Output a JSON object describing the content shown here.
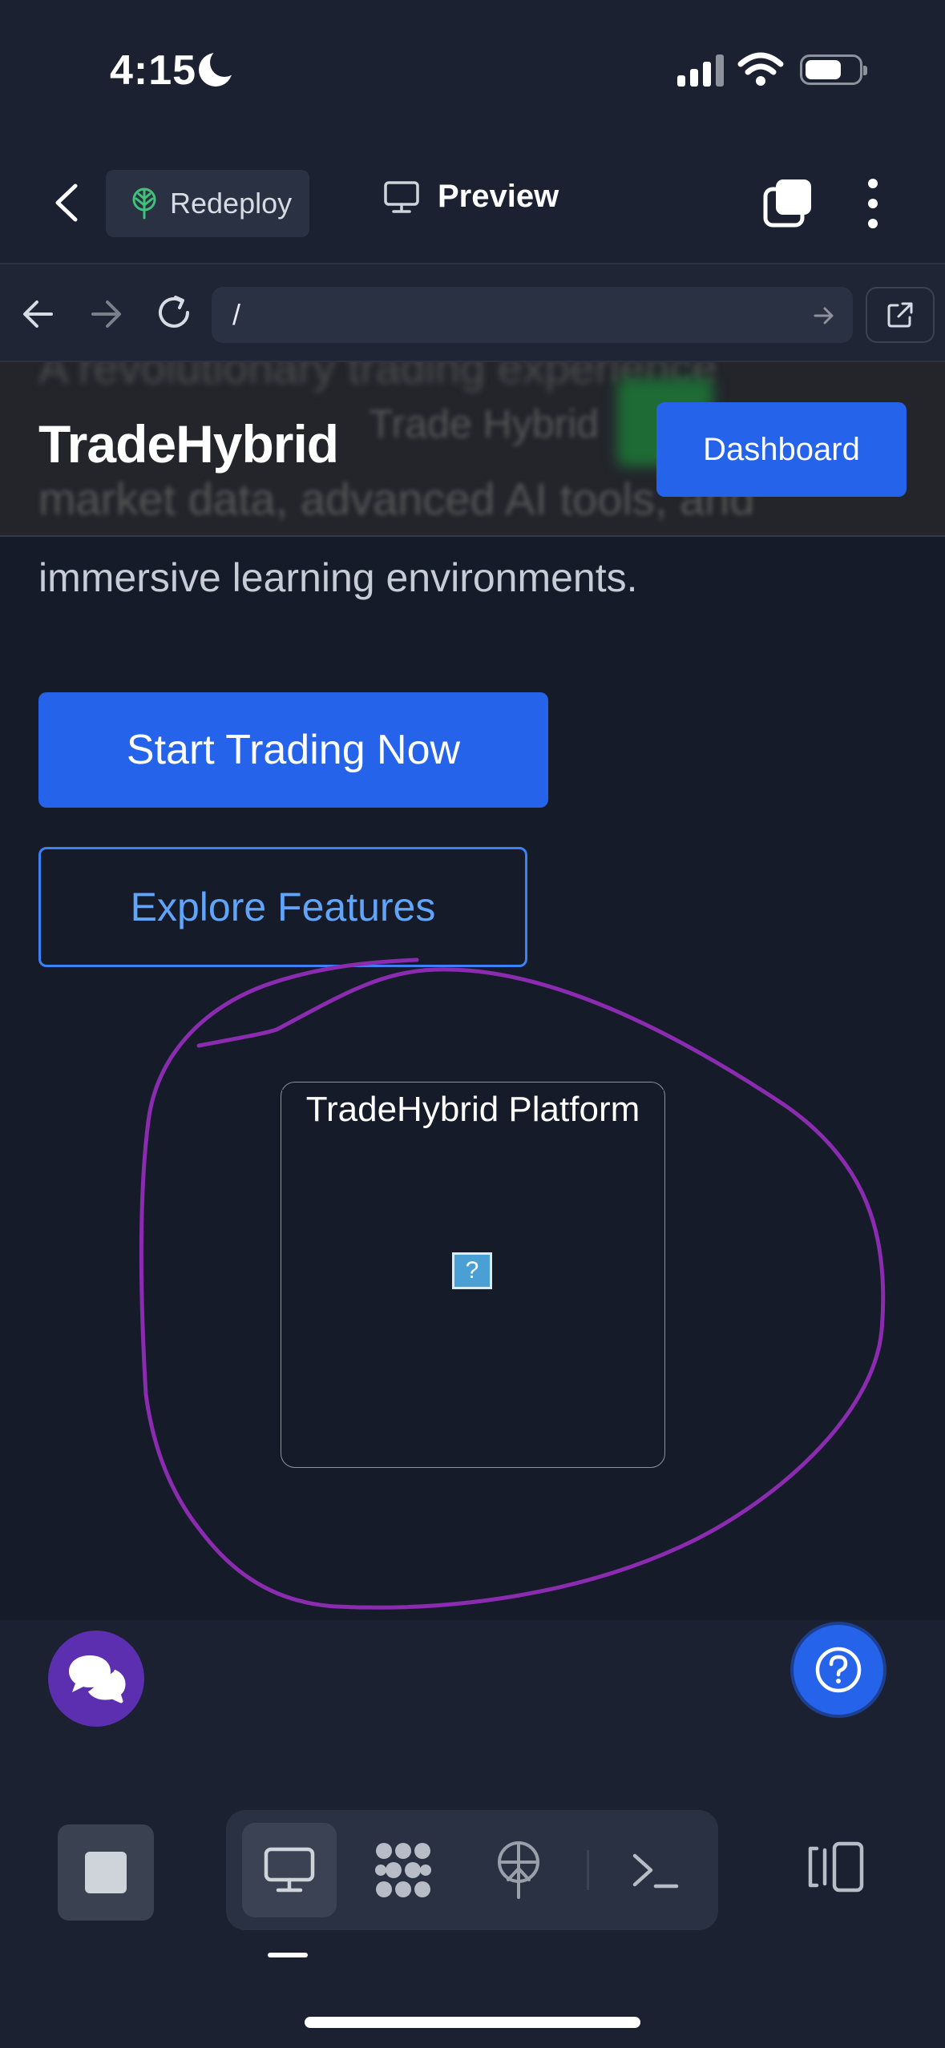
{
  "status_bar": {
    "time": "4:15",
    "icons": [
      "moon-icon",
      "cellular-signal-icon",
      "wifi-icon",
      "battery-icon"
    ]
  },
  "app_header": {
    "redeploy_label": "Redeploy",
    "preview_label": "Preview",
    "icons": [
      "chevron-left-icon",
      "deploy-tree-icon",
      "monitor-icon",
      "tabs-icon",
      "more-vertical-icon"
    ]
  },
  "browser_bar": {
    "url": "/",
    "icons": [
      "arrow-left-icon",
      "arrow-right-icon",
      "reload-icon",
      "go-arrow-icon",
      "external-link-icon"
    ]
  },
  "site": {
    "brand": "TradeHybrid",
    "dashboard_label": "Dashboard",
    "hero_text": "immersive learning environments.",
    "primary_cta": "Start Trading Now",
    "secondary_cta": "Explore Features",
    "platform_image_alt": "TradeHybrid Platform",
    "broken_image_glyph": "?",
    "ghost_text_bottom": "market data, advanced AI tools, and",
    "ghost_text_top": "A revolutionary trading experience",
    "ghost_text_middle": "Trade Hybrid"
  },
  "colors": {
    "accent": "#2563eb",
    "annotation": "#8a2bb0",
    "chat_fab": "#5b2fb0"
  },
  "fabs": {
    "chat_icon": "chat-bubbles-icon",
    "help_icon": "help-circle-icon"
  },
  "bottom_toolbar": {
    "items": [
      "stop-icon",
      "monitor-icon",
      "grid-dots-icon",
      "deploy-icon",
      "terminal-icon",
      "layout-panels-icon"
    ],
    "active": "monitor-icon"
  }
}
